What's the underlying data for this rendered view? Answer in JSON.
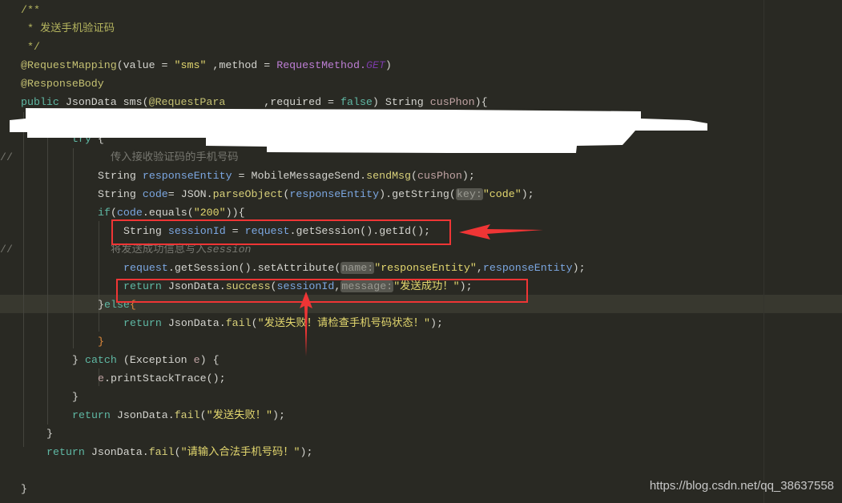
{
  "colors": {
    "background": "#292923",
    "keyword": "#5fb8a4",
    "string": "#e2d66e",
    "variable": "#7ba6e0",
    "highlight_box": "#ef3535"
  },
  "code_lines": [
    {
      "indent": 0,
      "tokens": [
        {
          "t": "/**",
          "c": "dc"
        }
      ]
    },
    {
      "indent": 0,
      "tokens": [
        {
          "t": " * 发送手机验证码",
          "c": "dc"
        }
      ]
    },
    {
      "indent": 0,
      "tokens": [
        {
          "t": " */",
          "c": "dc"
        }
      ]
    },
    {
      "indent": 0,
      "tokens": [
        {
          "t": "@RequestMapping",
          "c": "an"
        },
        {
          "t": "(value = ",
          "c": "pl"
        },
        {
          "t": "\"sms\"",
          "c": "st"
        },
        {
          "t": " ,method = ",
          "c": "pl"
        },
        {
          "t": "RequestMethod.",
          "c": "pu"
        },
        {
          "t": "GET",
          "c": "gt"
        },
        {
          "t": ")",
          "c": "pl"
        }
      ]
    },
    {
      "indent": 0,
      "tokens": [
        {
          "t": "@ResponseBody",
          "c": "an"
        }
      ]
    },
    {
      "indent": 0,
      "tokens": [
        {
          "t": "public ",
          "c": "kw"
        },
        {
          "t": "JsonData sms(",
          "c": "pl"
        },
        {
          "t": "@RequestPara",
          "c": "an"
        },
        {
          "t": "      ",
          "c": "gap"
        },
        {
          "t": ",required = ",
          "c": "pl"
        },
        {
          "t": "false",
          "c": "kw"
        },
        {
          "t": ") String ",
          "c": "pl"
        },
        {
          "t": "cusPhon",
          "c": "pr"
        },
        {
          "t": "){",
          "c": "pl"
        }
      ]
    },
    {
      "indent": 0,
      "tokens": []
    },
    {
      "indent": 8,
      "tokens": [
        {
          "t": "try",
          "c": "kw"
        },
        {
          "t": " {",
          "c": "pl"
        }
      ]
    },
    {
      "indent": 14,
      "comment": "//",
      "tokens": [
        {
          "t": "传入接收验证码的手机号码",
          "c": "cm"
        }
      ]
    },
    {
      "indent": 12,
      "tokens": [
        {
          "t": "String ",
          "c": "pl"
        },
        {
          "t": "responseEntity",
          "c": "vr"
        },
        {
          "t": " = MobileMessageSend.",
          "c": "pl"
        },
        {
          "t": "sendMsg",
          "c": "fn"
        },
        {
          "t": "(",
          "c": "pl"
        },
        {
          "t": "cusPhon",
          "c": "pr"
        },
        {
          "t": ");",
          "c": "pl"
        }
      ]
    },
    {
      "indent": 12,
      "tokens": [
        {
          "t": "String ",
          "c": "pl"
        },
        {
          "t": "code",
          "c": "vr"
        },
        {
          "t": "= JSON.",
          "c": "pl"
        },
        {
          "t": "parseObject",
          "c": "fn"
        },
        {
          "t": "(",
          "c": "pl"
        },
        {
          "t": "responseEntity",
          "c": "vr"
        },
        {
          "t": ").getString(",
          "c": "pl"
        },
        {
          "t": "key:",
          "c": "hint"
        },
        {
          "t": "\"code\"",
          "c": "st"
        },
        {
          "t": ");",
          "c": "pl"
        }
      ]
    },
    {
      "indent": 12,
      "tokens": [
        {
          "t": "if",
          "c": "kw"
        },
        {
          "t": "(",
          "c": "pl"
        },
        {
          "t": "code",
          "c": "vr"
        },
        {
          "t": ".equals(",
          "c": "pl"
        },
        {
          "t": "\"200\"",
          "c": "st"
        },
        {
          "t": ")){",
          "c": "pl"
        }
      ]
    },
    {
      "indent": 16,
      "tokens": [
        {
          "t": "String ",
          "c": "pl"
        },
        {
          "t": "sessionId",
          "c": "vr"
        },
        {
          "t": " = ",
          "c": "pl"
        },
        {
          "t": "request",
          "c": "vr"
        },
        {
          "t": ".getSession().getId();",
          "c": "pl"
        }
      ]
    },
    {
      "indent": 14,
      "comment": "//",
      "tokens": [
        {
          "t": "将发送成功信息写入",
          "c": "cm"
        },
        {
          "t": "session",
          "c": "ci"
        }
      ]
    },
    {
      "indent": 16,
      "tokens": [
        {
          "t": "request",
          "c": "vr"
        },
        {
          "t": ".getSession().setAttribute(",
          "c": "pl"
        },
        {
          "t": "name:",
          "c": "hint"
        },
        {
          "t": "\"responseEntity\"",
          "c": "st"
        },
        {
          "t": ",",
          "c": "pl"
        },
        {
          "t": "responseEntity",
          "c": "vr"
        },
        {
          "t": ");",
          "c": "pl"
        }
      ]
    },
    {
      "indent": 16,
      "tokens": [
        {
          "t": "return ",
          "c": "kw"
        },
        {
          "t": "JsonData.",
          "c": "pl"
        },
        {
          "t": "success",
          "c": "fn"
        },
        {
          "t": "(",
          "c": "pl"
        },
        {
          "t": "sessionId",
          "c": "vr"
        },
        {
          "t": ",",
          "c": "pl"
        },
        {
          "t": "message:",
          "c": "hint"
        },
        {
          "t": "\"发送成功！\"",
          "c": "st"
        },
        {
          "t": ");",
          "c": "pl"
        }
      ]
    },
    {
      "indent": 12,
      "current": true,
      "tokens": [
        {
          "t": "}",
          "c": "pl"
        },
        {
          "t": "else",
          "c": "kw"
        },
        {
          "t": "{",
          "c": "br"
        }
      ]
    },
    {
      "indent": 16,
      "tokens": [
        {
          "t": "return ",
          "c": "kw"
        },
        {
          "t": "JsonData.",
          "c": "pl"
        },
        {
          "t": "fail",
          "c": "fn"
        },
        {
          "t": "(",
          "c": "pl"
        },
        {
          "t": "\"发送失败！请检查手机号码状态！\"",
          "c": "st"
        },
        {
          "t": ");",
          "c": "pl"
        }
      ]
    },
    {
      "indent": 12,
      "tokens": [
        {
          "t": "}",
          "c": "br"
        }
      ]
    },
    {
      "indent": 8,
      "tokens": [
        {
          "t": "} ",
          "c": "pl"
        },
        {
          "t": "catch",
          "c": "kw"
        },
        {
          "t": " (Exception ",
          "c": "pl"
        },
        {
          "t": "e",
          "c": "pr"
        },
        {
          "t": ") {",
          "c": "pl"
        }
      ]
    },
    {
      "indent": 12,
      "tokens": [
        {
          "t": "e",
          "c": "pr"
        },
        {
          "t": ".printStackTrace();",
          "c": "pl"
        }
      ]
    },
    {
      "indent": 8,
      "tokens": [
        {
          "t": "}",
          "c": "pl"
        }
      ]
    },
    {
      "indent": 8,
      "tokens": [
        {
          "t": "return ",
          "c": "kw"
        },
        {
          "t": "JsonData.",
          "c": "pl"
        },
        {
          "t": "fail",
          "c": "fn"
        },
        {
          "t": "(",
          "c": "pl"
        },
        {
          "t": "\"发送失败！\"",
          "c": "st"
        },
        {
          "t": ");",
          "c": "pl"
        }
      ]
    },
    {
      "indent": 4,
      "tokens": [
        {
          "t": "}",
          "c": "pl"
        }
      ]
    },
    {
      "indent": 4,
      "tokens": [
        {
          "t": "return ",
          "c": "kw"
        },
        {
          "t": "JsonData.",
          "c": "pl"
        },
        {
          "t": "fail",
          "c": "fn"
        },
        {
          "t": "(",
          "c": "pl"
        },
        {
          "t": "\"请输入合法手机号码！\"",
          "c": "st"
        },
        {
          "t": ");",
          "c": "pl"
        }
      ]
    },
    {
      "indent": 0,
      "tokens": []
    },
    {
      "indent": 0,
      "tokens": [
        {
          "t": "}",
          "c": "pl"
        }
      ]
    }
  ],
  "watermark": "https://blog.csdn.net/qq_38637558"
}
